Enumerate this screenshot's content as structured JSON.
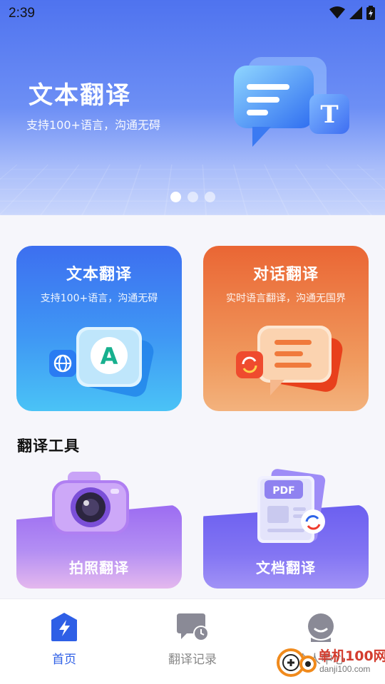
{
  "status_bar": {
    "time": "2:39",
    "icons": [
      "wifi-icon",
      "signal-icon",
      "battery-icon"
    ]
  },
  "banner": {
    "title": "文本翻译",
    "subtitle": "支持100+语言，沟通无碍",
    "page_count": 3,
    "active_page": 1
  },
  "features": [
    {
      "title": "文本翻译",
      "subtitle": "支持100+语言，沟通无碍",
      "icon": "text-translate-icon"
    },
    {
      "title": "对话翻译",
      "subtitle": "实时语言翻译，沟通无国界",
      "icon": "dialog-translate-icon"
    }
  ],
  "tools": {
    "section_title": "翻译工具",
    "items": [
      {
        "label": "拍照翻译",
        "icon": "camera-icon"
      },
      {
        "label": "文档翻译",
        "icon": "pdf-document-icon"
      }
    ]
  },
  "bottom_nav": {
    "items": [
      {
        "label": "首页",
        "icon": "home-bolt-icon",
        "active": true
      },
      {
        "label": "翻译记录",
        "icon": "history-chat-icon",
        "active": false
      },
      {
        "label": "个人中心",
        "icon": "profile-icon",
        "active": false
      }
    ]
  },
  "watermark": {
    "name": "单机100网",
    "url": "danji100.com"
  },
  "colors": {
    "accent": "#2e5fe6",
    "banner_top": "#4f73ef",
    "card_text": "#3d6ff0",
    "card_dialog": "#ea6634",
    "tool_photo": "#9c6cf2",
    "tool_doc": "#6b5ff0"
  }
}
